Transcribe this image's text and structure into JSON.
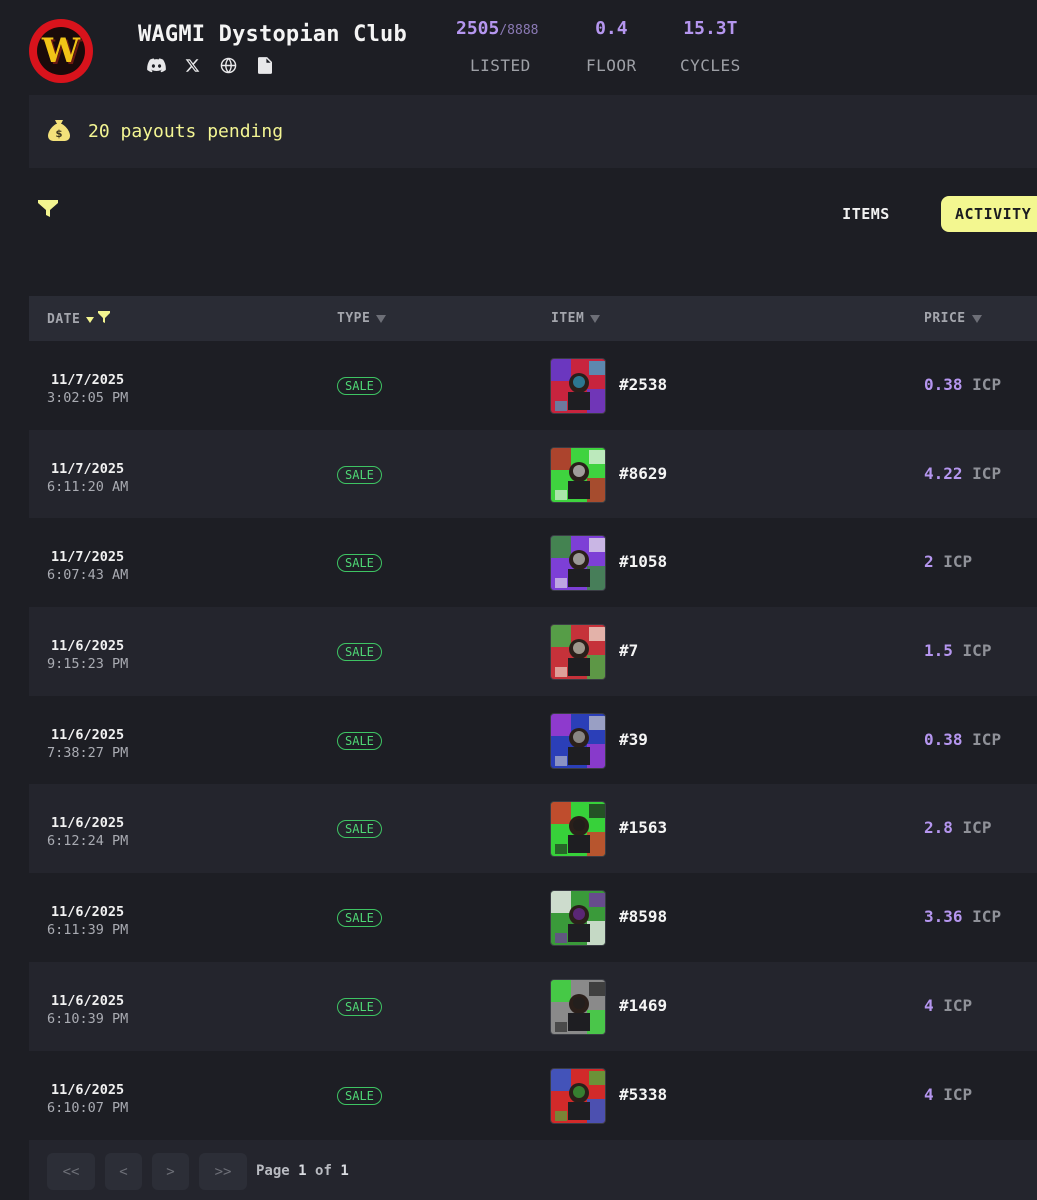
{
  "header": {
    "logo_letter": "W",
    "collection_name": "WAGMI Dystopian Club",
    "social_icons": [
      "discord-icon",
      "x-twitter-icon",
      "globe-icon",
      "document-icon"
    ],
    "stats": {
      "listed": {
        "value": "2505",
        "total": "/8888",
        "label": "LISTED"
      },
      "floor": {
        "value": "0.4",
        "label": "FLOOR"
      },
      "cycles": {
        "value": "15.3T",
        "label": "CYCLES"
      }
    }
  },
  "payouts": {
    "icon": "money-bag-icon",
    "text": "20 payouts pending"
  },
  "tabs": {
    "items": "ITEMS",
    "activity": "ACTIVITY",
    "active": "ACTIVITY"
  },
  "table": {
    "headers": {
      "date": "DATE",
      "type": "TYPE",
      "item": "ITEM",
      "price": "PRICE"
    },
    "rows": [
      {
        "date": "11/7/2025",
        "time": "3:02:05 PM",
        "type": "SALE",
        "item": "#2538",
        "price": "0.38",
        "currency": "ICP",
        "thumb": [
          "#c8243e",
          "#5a3bd6",
          "#2fb3e0"
        ]
      },
      {
        "date": "11/7/2025",
        "time": "6:11:20 AM",
        "type": "SALE",
        "item": "#8629",
        "price": "4.22",
        "currency": "ICP",
        "thumb": [
          "#3fd33f",
          "#c02a2a",
          "#f2f2f2"
        ]
      },
      {
        "date": "11/7/2025",
        "time": "6:07:43 AM",
        "type": "SALE",
        "item": "#1058",
        "price": "2",
        "currency": "ICP",
        "thumb": [
          "#7d3fd6",
          "#3a8f3a",
          "#e9e9e9"
        ]
      },
      {
        "date": "11/6/2025",
        "time": "9:15:23 PM",
        "type": "SALE",
        "item": "#7",
        "price": "1.5",
        "currency": "ICP",
        "thumb": [
          "#c6323a",
          "#42b04a",
          "#efe8d8"
        ]
      },
      {
        "date": "11/6/2025",
        "time": "7:38:27 PM",
        "type": "SALE",
        "item": "#39",
        "price": "0.38",
        "currency": "ICP",
        "thumb": [
          "#2b3fb8",
          "#a03ad0",
          "#c9c9c9"
        ]
      },
      {
        "date": "11/6/2025",
        "time": "6:12:24 PM",
        "type": "SALE",
        "item": "#1563",
        "price": "2.8",
        "currency": "ICP",
        "thumb": [
          "#37d13a",
          "#d7362c",
          "#1c1c1c"
        ]
      },
      {
        "date": "11/6/2025",
        "time": "6:11:39 PM",
        "type": "SALE",
        "item": "#8598",
        "price": "3.36",
        "currency": "ICP",
        "thumb": [
          "#3a9a3a",
          "#e8e8e8",
          "#7b2bb0"
        ]
      },
      {
        "date": "11/6/2025",
        "time": "6:10:39 PM",
        "type": "SALE",
        "item": "#1469",
        "price": "4",
        "currency": "ICP",
        "thumb": [
          "#8a8a8a",
          "#39d43a",
          "#202020"
        ]
      },
      {
        "date": "11/6/2025",
        "time": "6:10:07 PM",
        "type": "SALE",
        "item": "#5338",
        "price": "4",
        "currency": "ICP",
        "thumb": [
          "#d22a2a",
          "#2a5ad2",
          "#3fbf3f"
        ]
      }
    ]
  },
  "pagination": {
    "first": "<<",
    "prev": "<",
    "next": ">",
    "last": ">>",
    "page_label": "Page",
    "current": "1",
    "of_label": "of",
    "total": "1"
  }
}
